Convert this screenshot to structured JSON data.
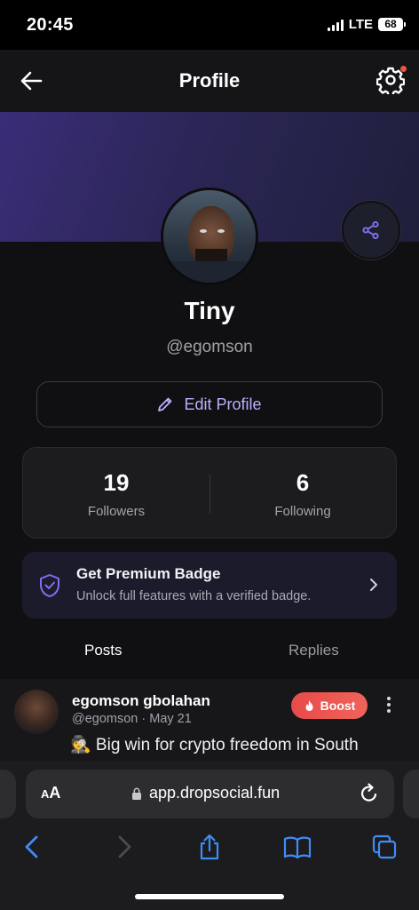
{
  "status": {
    "time": "20:45",
    "network": "LTE",
    "battery": "68"
  },
  "appbar": {
    "title": "Profile",
    "back_icon": "arrow-left-icon",
    "settings_icon": "gear-icon",
    "notification_dot_color": "#f05545"
  },
  "profile": {
    "name": "Tiny",
    "handle": "@egomson",
    "edit_label": "Edit Profile",
    "banner_colors": [
      "#3a2d78",
      "#1e1f3a"
    ]
  },
  "stats": {
    "followers_count": "19",
    "followers_label": "Followers",
    "following_count": "6",
    "following_label": "Following"
  },
  "premium": {
    "title": "Get Premium Badge",
    "subtitle": "Unlock full features with a verified badge."
  },
  "tabs": [
    {
      "label": "Posts",
      "active": true
    },
    {
      "label": "Replies",
      "active": false
    }
  ],
  "post": {
    "author": "egomson gbolahan",
    "meta": "@egomson · May 21",
    "text": "🕵️ Big win for crypto freedom in South",
    "boost_label": "Boost"
  },
  "browser": {
    "text_size_label": "AA",
    "url": "app.dropsocial.fun"
  },
  "colors": {
    "accent": "#7e6ff0",
    "accent_text": "#b9b0ff",
    "boost": "#e84a4a"
  }
}
